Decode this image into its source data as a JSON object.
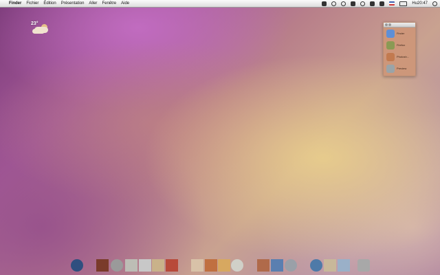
{
  "menubar": {
    "apple": "",
    "items": [
      "Finder",
      "Fichier",
      "Édition",
      "Présentation",
      "Aller",
      "Fenêtre",
      "Aide"
    ],
    "clock": "Hu20:47",
    "status_icons": [
      "scripts-icon",
      "sync-icon",
      "timer-icon",
      "mail-icon",
      "bluetooth-icon",
      "wifi-icon",
      "volume-icon",
      "flag-icon",
      "battery-icon",
      "spotlight-icon"
    ]
  },
  "weather": {
    "temperature": "23°",
    "condition": "partly-cloudy"
  },
  "drawer": {
    "items": [
      {
        "label": "Finder",
        "icon": "finder-icon",
        "color": "#5f8fd6"
      },
      {
        "label": "Firefox",
        "icon": "firefox-icon",
        "color": "#8a9a54"
      },
      {
        "label": "Photosh...",
        "icon": "photoshop-icon",
        "color": "#c27a4f"
      },
      {
        "label": "Preview",
        "icon": "preview-icon",
        "color": "#9aa4a8"
      }
    ]
  },
  "dock": {
    "icons": [
      {
        "name": "globe-icon",
        "color": "#2f4f7f"
      },
      {
        "name": "brush-icon",
        "color": "#7a3b2a"
      },
      {
        "name": "gear-icon",
        "color": "#9a9a9a"
      },
      {
        "name": "notepad-icon",
        "color": "#bdbdb5"
      },
      {
        "name": "wrench-icon",
        "color": "#c8c8c8"
      },
      {
        "name": "music-icon",
        "color": "#c9b28a"
      },
      {
        "name": "tools-icon",
        "color": "#b84a3a"
      },
      {
        "name": "pen-icon",
        "color": "#d8c2a8"
      },
      {
        "name": "paintbrush-icon",
        "color": "#c07040"
      },
      {
        "name": "pencil-icon",
        "color": "#d7a860"
      },
      {
        "name": "magnifier-icon",
        "color": "#d0d0c8"
      },
      {
        "name": "rocket-icon",
        "color": "#b06a4a"
      },
      {
        "name": "network-icon",
        "color": "#5a7fb0"
      },
      {
        "name": "speaker-icon",
        "color": "#9aa0a8"
      },
      {
        "name": "earth-icon",
        "color": "#4e7aa8"
      },
      {
        "name": "mail-icon",
        "color": "#c8b89a"
      },
      {
        "name": "photos-icon",
        "color": "#9ab0c8"
      },
      {
        "name": "trash-icon",
        "color": "#a8a8a8"
      }
    ]
  }
}
